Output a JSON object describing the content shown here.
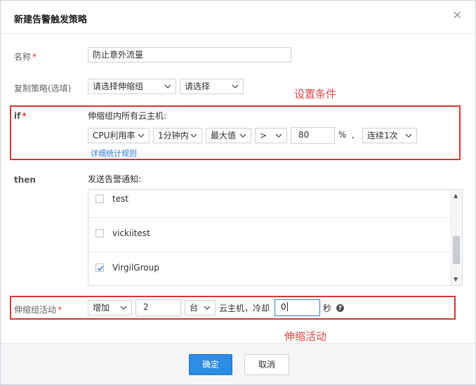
{
  "dialog": {
    "title": "新建告警触发策略",
    "close_icon": "close-icon"
  },
  "name_field": {
    "label": "名称",
    "required_mark": "*",
    "value": "防止意外流量"
  },
  "copy_policy": {
    "label": "复制策略(选填)",
    "group_select": "请选择伸缩组",
    "policy_select": "请选择"
  },
  "if_section": {
    "label": "if",
    "required_mark": "*",
    "heading": "伸缩组内所有云主机:",
    "metric_select": "CPU利用率",
    "period_select": "1分钟内",
    "stat_select": "最大值",
    "operator_select": ">",
    "threshold_value": "80",
    "unit": "%",
    "comma": ",",
    "times_select": "连续1次",
    "detail_link": "详细统计规则",
    "annotation": "设置条件"
  },
  "then_section": {
    "label": "then",
    "heading": "发送告警通知:",
    "items": [
      {
        "label": "test",
        "checked": false
      },
      {
        "label": "vickiitest",
        "checked": false
      },
      {
        "label": "VirgilGroup",
        "checked": true
      }
    ]
  },
  "activity": {
    "label": "伸缩组活动",
    "required_mark": "*",
    "action_select": "增加",
    "count_value": "2",
    "count_unit_select": "台",
    "mid_text": "云主机，冷却",
    "cooldown_value": "0",
    "seconds_text": "秒",
    "help_icon": "?",
    "annotation": "伸缩活动"
  },
  "footer": {
    "confirm_label": "确定",
    "cancel_label": "取消"
  },
  "colors": {
    "primary": "#2d8ce3",
    "annotation_red": "#e03a3a",
    "link": "#2a78d6",
    "required": "#e4393c"
  }
}
